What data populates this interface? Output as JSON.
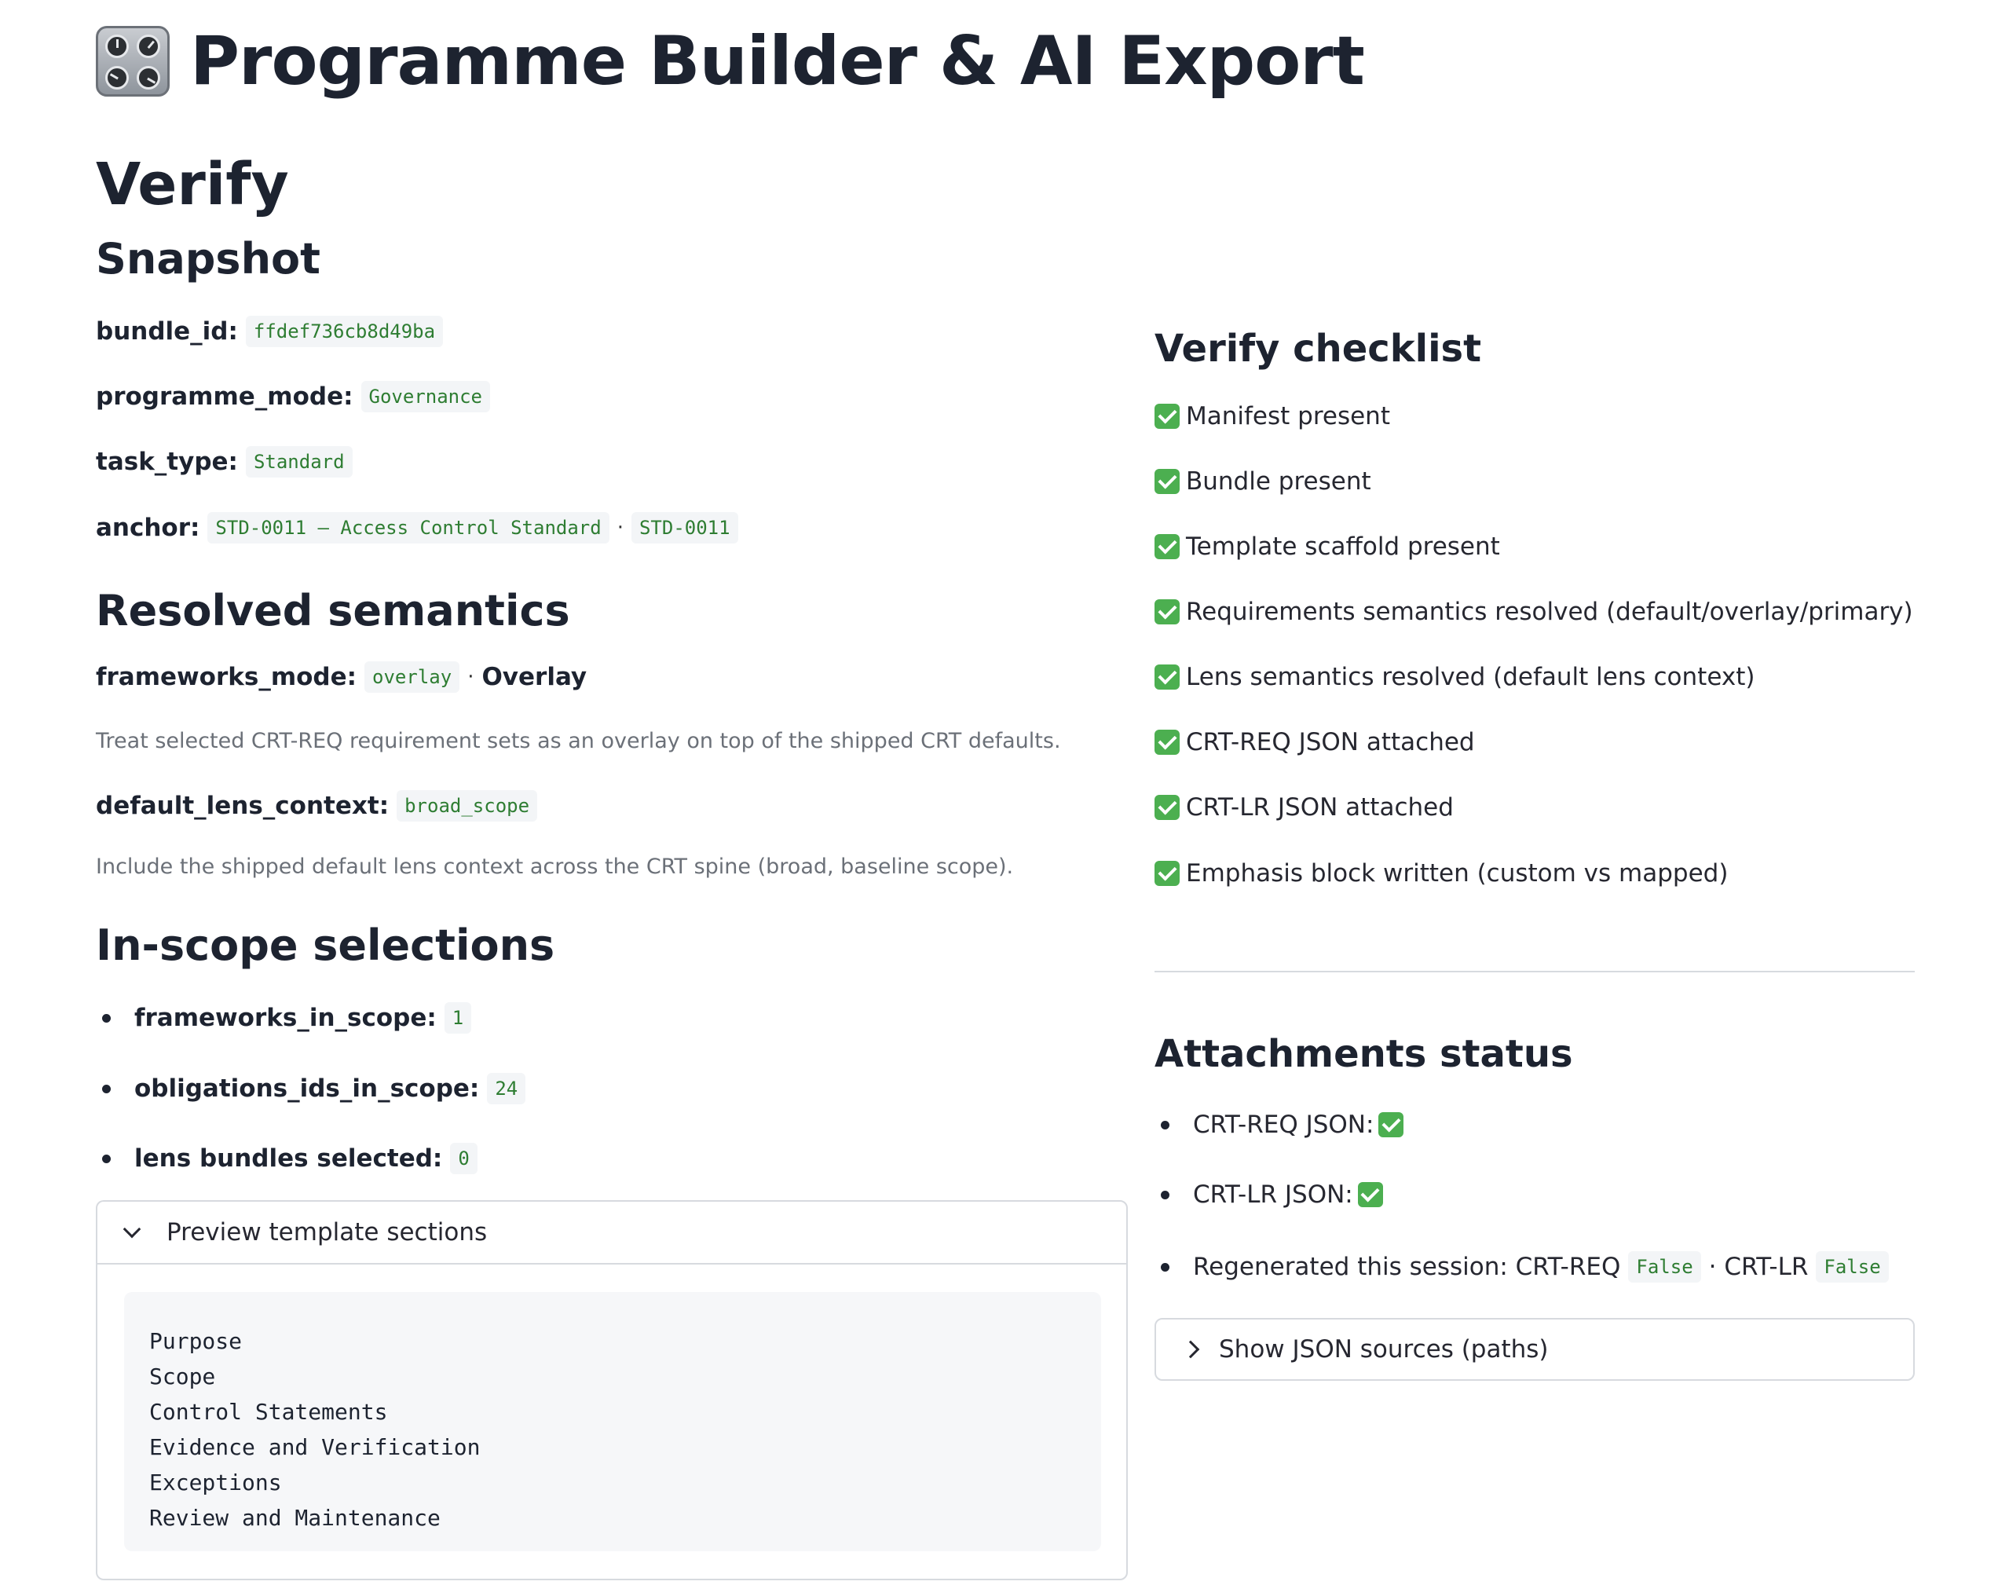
{
  "app": {
    "title": "Programme Builder & AI Export",
    "icon": "control-knobs-icon"
  },
  "page": {
    "heading": "Verify"
  },
  "snapshot": {
    "heading": "Snapshot",
    "bundle_id": {
      "label": "bundle_id:",
      "value": "ffdef736cb8d49ba"
    },
    "programme_mode": {
      "label": "programme_mode:",
      "value": "Governance"
    },
    "task_type": {
      "label": "task_type:",
      "value": "Standard"
    },
    "anchor": {
      "label": "anchor:",
      "value": "STD-0011 — Access Control Standard",
      "id": "STD-0011",
      "separator": "·"
    }
  },
  "semantics": {
    "heading": "Resolved semantics",
    "frameworks_mode": {
      "label": "frameworks_mode:",
      "code": "overlay",
      "separator": "·",
      "name": "Overlay",
      "description": "Treat selected CRT-REQ requirement sets as an overlay on top of the shipped CRT defaults."
    },
    "default_lens_context": {
      "label": "default_lens_context:",
      "code": "broad_scope",
      "description": "Include the shipped default lens context across the CRT spine (broad, baseline scope)."
    }
  },
  "in_scope": {
    "heading": "In-scope selections",
    "items": [
      {
        "label": "frameworks_in_scope:",
        "value": "1"
      },
      {
        "label": "obligations_ids_in_scope:",
        "value": "24"
      },
      {
        "label": "lens bundles selected:",
        "value": "0"
      }
    ]
  },
  "preview": {
    "label": "Preview template sections",
    "sections": [
      "Purpose",
      "Scope",
      "Control Statements",
      "Evidence and Verification",
      "Exceptions",
      "Review and Maintenance"
    ]
  },
  "checklist": {
    "heading": "Verify checklist",
    "items": [
      "Manifest present",
      "Bundle present",
      "Template scaffold present",
      "Requirements semantics resolved (default/overlay/primary)",
      "Lens semantics resolved (default lens context)",
      "CRT-REQ JSON attached",
      "CRT-LR JSON attached",
      "Emphasis block written (custom vs mapped)"
    ]
  },
  "attachments": {
    "heading": "Attachments status",
    "crt_req": "CRT-REQ JSON:",
    "crt_lr": "CRT-LR JSON:",
    "regen_label": "Regenerated this session: CRT-REQ",
    "regen_req_value": "False",
    "regen_sep": "· CRT-LR",
    "regen_lr_value": "False"
  },
  "json_sources": {
    "label": "Show JSON sources (paths)"
  },
  "colors": {
    "check": "#4caf50",
    "code_text": "#2e7d32",
    "code_bg": "#f3f5f7"
  }
}
